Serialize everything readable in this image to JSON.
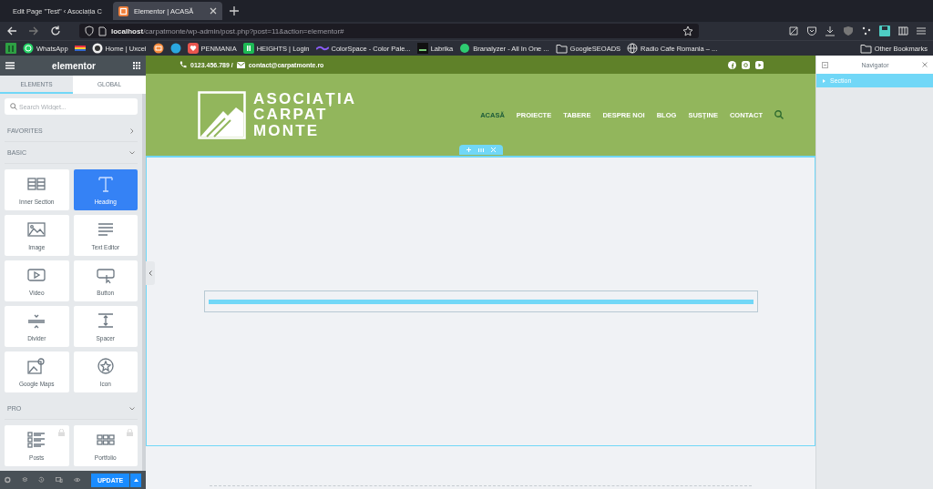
{
  "browser": {
    "tabs": [
      {
        "title": "Edit Page \"Test\" ‹ Asociația C",
        "selected": false
      },
      {
        "title": "Elementor | ACASĂ",
        "selected": true
      }
    ],
    "url": "**localhost**/carpatmonte/wp-admin/post.php?post=11&action=elementor#",
    "bookmarks": [
      {
        "kind": "apps"
      },
      {
        "kind": "whatsapp",
        "label": "WhatsApp"
      },
      {
        "kind": "flag"
      },
      {
        "kind": "uxcel",
        "label": "Home | Uxcel"
      },
      {
        "kind": "orange"
      },
      {
        "kind": "blue"
      },
      {
        "kind": "heart",
        "label": "PENMANIA"
      },
      {
        "kind": "heights",
        "label": "HEIGHTS | Login"
      },
      {
        "kind": "colorspace",
        "label": "ColorSpace - Color Pale..."
      },
      {
        "kind": "labrika",
        "label": "Labrika"
      },
      {
        "kind": "branalyzer",
        "label": "Branalyzer - All In One ..."
      },
      {
        "kind": "folder",
        "label": "GoogleSEOADS"
      },
      {
        "kind": "globe",
        "label": "Radio Cafe Romania – ..."
      }
    ],
    "other_bookmarks": "Other Bookmarks"
  },
  "panel": {
    "brand": "elementor",
    "tabs": [
      {
        "label": "ELEMENTS",
        "selected": true
      },
      {
        "label": "GLOBAL",
        "selected": false
      }
    ],
    "search": {
      "placeholder": "Search Widget..."
    },
    "sections": [
      {
        "title": "FAVORITES",
        "expanded": false
      },
      {
        "title": "BASIC",
        "expanded": true,
        "widgets": [
          {
            "kind": "columns",
            "label": "Inner Section",
            "selected": false,
            "locked": false
          },
          {
            "kind": "heading",
            "label": "Heading",
            "selected": true,
            "locked": false
          },
          {
            "kind": "image",
            "label": "Image",
            "selected": false,
            "locked": false
          },
          {
            "kind": "text",
            "label": "Text Editor",
            "selected": false,
            "locked": false
          },
          {
            "kind": "video",
            "label": "Video",
            "selected": false,
            "locked": false
          },
          {
            "kind": "button",
            "label": "Button",
            "selected": false,
            "locked": false
          },
          {
            "kind": "divider",
            "label": "Divider",
            "selected": false,
            "locked": false
          },
          {
            "kind": "spacer",
            "label": "Spacer",
            "selected": false,
            "locked": false
          },
          {
            "kind": "map",
            "label": "Google Maps",
            "selected": false,
            "locked": false
          },
          {
            "kind": "star",
            "label": "Icon",
            "selected": false,
            "locked": false
          }
        ]
      },
      {
        "title": "PRO",
        "expanded": true,
        "widgets": [
          {
            "kind": "posts",
            "label": "Posts",
            "selected": false,
            "locked": true
          },
          {
            "kind": "portfolio",
            "label": "Portfolio",
            "selected": false,
            "locked": true
          }
        ]
      }
    ],
    "update_button": "UPDATE"
  },
  "site": {
    "phone": "0123.456.789 /",
    "email": "contact@carpatmonte.ro",
    "logo_lines": [
      "ASOCIAȚIA",
      "CARPAT",
      "MONTE"
    ],
    "menu": [
      {
        "label": "ACASĂ",
        "selected": true
      },
      {
        "label": "PROIECTE",
        "selected": false
      },
      {
        "label": "TABERE",
        "selected": false
      },
      {
        "label": "DESPRE NOI",
        "selected": false
      },
      {
        "label": "BLOG",
        "selected": false
      },
      {
        "label": "SUSȚINE",
        "selected": false
      },
      {
        "label": "CONTACT",
        "selected": false
      }
    ]
  },
  "navigator": {
    "title": "Navigator",
    "items": [
      {
        "label": "Section",
        "selected": true
      }
    ]
  }
}
